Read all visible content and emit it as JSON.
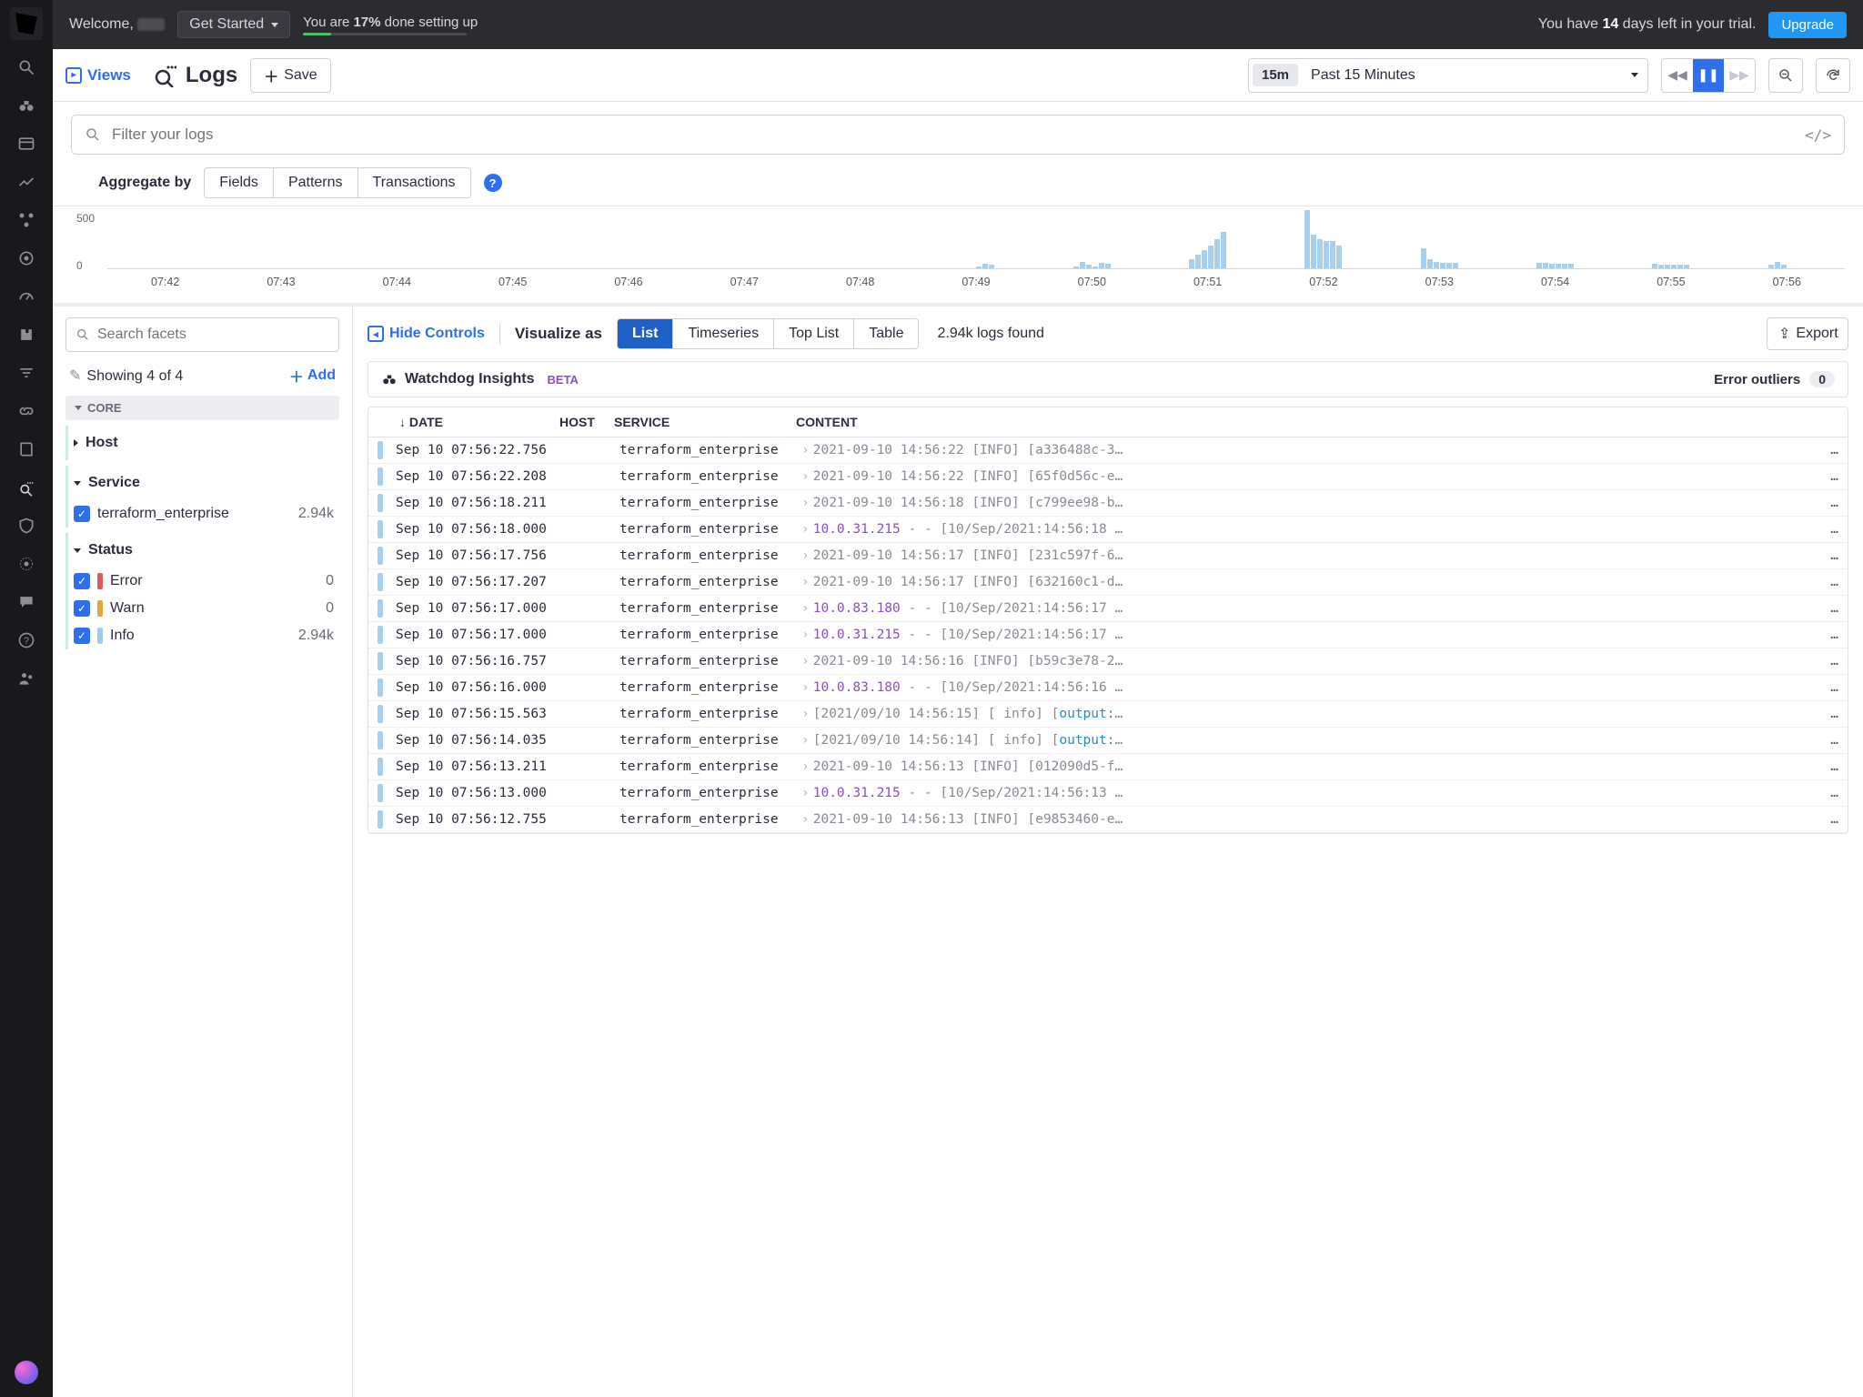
{
  "topbar": {
    "welcome": "Welcome,",
    "get_started": "Get Started",
    "progress_pre": "You are ",
    "progress_pct": "17%",
    "progress_post": " done setting up",
    "trial_pre": "You have ",
    "trial_days": "14",
    "trial_post": " days left in your trial.",
    "upgrade": "Upgrade"
  },
  "toolbar": {
    "views": "Views",
    "title": "Logs",
    "save": "Save",
    "tr_badge": "15m",
    "tr_label": "Past 15 Minutes"
  },
  "search": {
    "placeholder": "Filter your logs",
    "agg_label": "Aggregate by",
    "agg_tabs": [
      "Fields",
      "Patterns",
      "Transactions"
    ]
  },
  "chart_data": {
    "type": "bar",
    "title": "",
    "xlabel": "",
    "ylabel": "",
    "ylim": [
      0,
      500
    ],
    "categories": [
      "07:42",
      "07:43",
      "07:44",
      "07:45",
      "07:46",
      "07:47",
      "07:48",
      "07:49",
      "07:50",
      "07:51",
      "07:52",
      "07:53",
      "07:54",
      "07:55",
      "07:56"
    ],
    "minute_bins": {
      "07:42": [
        0,
        0,
        0,
        0,
        0,
        0
      ],
      "07:43": [
        0,
        0,
        0,
        0,
        0,
        0
      ],
      "07:44": [
        0,
        0,
        0,
        0,
        0,
        0
      ],
      "07:45": [
        0,
        0,
        0,
        0,
        0,
        0
      ],
      "07:46": [
        0,
        0,
        0,
        0,
        0,
        0
      ],
      "07:47": [
        0,
        0,
        0,
        0,
        0,
        0
      ],
      "07:48": [
        0,
        0,
        0,
        0,
        0,
        0
      ],
      "07:49": [
        0,
        0,
        0,
        20,
        40,
        30
      ],
      "07:50": [
        20,
        60,
        30,
        20,
        50,
        40
      ],
      "07:51": [
        80,
        120,
        160,
        200,
        260,
        320
      ],
      "07:52": [
        520,
        300,
        260,
        240,
        240,
        200
      ],
      "07:53": [
        180,
        80,
        60,
        50,
        50,
        45
      ],
      "07:54": [
        45,
        45,
        40,
        40,
        40,
        40
      ],
      "07:55": [
        40,
        35,
        35,
        35,
        35,
        35
      ],
      "07:56": [
        35,
        60,
        35,
        0,
        0,
        0
      ]
    }
  },
  "facets": {
    "search_placeholder": "Search facets",
    "showing": "Showing 4 of 4",
    "add": "Add",
    "core": "CORE",
    "groups": {
      "host": "Host",
      "service": "Service",
      "status": "Status"
    },
    "service_item": {
      "label": "terraform_enterprise",
      "count": "2.94k"
    },
    "status_items": [
      {
        "label": "Error",
        "count": "0",
        "cls": "pill-err"
      },
      {
        "label": "Warn",
        "count": "0",
        "cls": "pill-warn"
      },
      {
        "label": "Info",
        "count": "2.94k",
        "cls": "pill-info"
      }
    ]
  },
  "results": {
    "hide": "Hide Controls",
    "vis_label": "Visualize as",
    "vis_tabs": [
      "List",
      "Timeseries",
      "Top List",
      "Table"
    ],
    "found": "2.94k logs found",
    "export": "Export",
    "watchdog": "Watchdog Insights",
    "beta": "BETA",
    "error_outliers": "Error outliers",
    "eo_count": "0",
    "headers": {
      "date": "DATE",
      "host": "HOST",
      "service": "SERVICE",
      "content": "CONTENT"
    },
    "rows": [
      {
        "date": "Sep 10 07:56:22.756",
        "svc": "terraform_enterprise",
        "c": "2021-09-10 14:56:22 [INFO] [a336488c-3…"
      },
      {
        "date": "Sep 10 07:56:22.208",
        "svc": "terraform_enterprise",
        "c": "2021-09-10 14:56:22 [INFO] [65f0d56c-e…"
      },
      {
        "date": "Sep 10 07:56:18.211",
        "svc": "terraform_enterprise",
        "c": "2021-09-10 14:56:18 [INFO] [c799ee98-b…"
      },
      {
        "date": "Sep 10 07:56:18.000",
        "svc": "terraform_enterprise",
        "c": "<ip>10.0.31.215</ip> - - [10/Sep/2021:14:56:18 …"
      },
      {
        "date": "Sep 10 07:56:17.756",
        "svc": "terraform_enterprise",
        "c": "2021-09-10 14:56:17 [INFO] [231c597f-6…"
      },
      {
        "date": "Sep 10 07:56:17.207",
        "svc": "terraform_enterprise",
        "c": "2021-09-10 14:56:17 [INFO] [632160c1-d…"
      },
      {
        "date": "Sep 10 07:56:17.000",
        "svc": "terraform_enterprise",
        "c": "<ip>10.0.83.180</ip> - - [10/Sep/2021:14:56:17 …"
      },
      {
        "date": "Sep 10 07:56:17.000",
        "svc": "terraform_enterprise",
        "c": "<ip>10.0.31.215</ip> - - [10/Sep/2021:14:56:17 …"
      },
      {
        "date": "Sep 10 07:56:16.757",
        "svc": "terraform_enterprise",
        "c": "2021-09-10 14:56:16 [INFO] [b59c3e78-2…"
      },
      {
        "date": "Sep 10 07:56:16.000",
        "svc": "terraform_enterprise",
        "c": "<ip>10.0.83.180</ip> - - [10/Sep/2021:14:56:16 …"
      },
      {
        "date": "Sep 10 07:56:15.563",
        "svc": "terraform_enterprise",
        "c": "[2021/09/10 14:56:15] [ info] [<out>output:</out>…"
      },
      {
        "date": "Sep 10 07:56:14.035",
        "svc": "terraform_enterprise",
        "c": "[2021/09/10 14:56:14] [ info] [<out>output:</out>…"
      },
      {
        "date": "Sep 10 07:56:13.211",
        "svc": "terraform_enterprise",
        "c": "2021-09-10 14:56:13 [INFO] [012090d5-f…"
      },
      {
        "date": "Sep 10 07:56:13.000",
        "svc": "terraform_enterprise",
        "c": "<ip>10.0.31.215</ip> - - [10/Sep/2021:14:56:13 …"
      },
      {
        "date": "Sep 10 07:56:12.755",
        "svc": "terraform_enterprise",
        "c": "2021-09-10 14:56:13 [INFO] [e9853460-e…"
      }
    ]
  }
}
